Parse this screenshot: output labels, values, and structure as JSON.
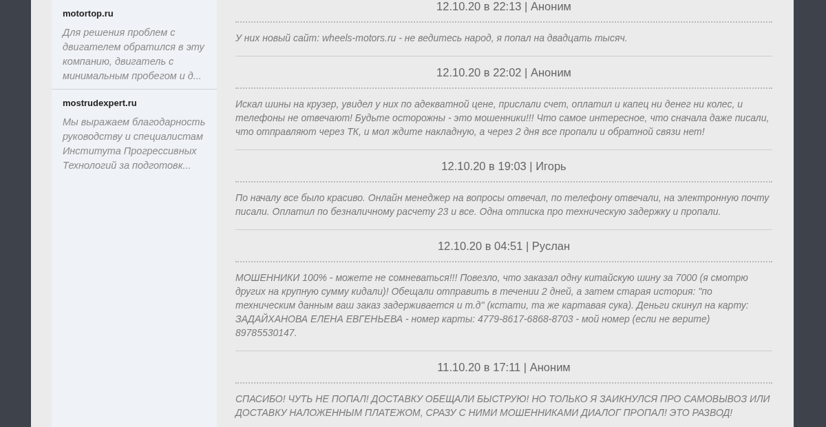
{
  "sidebar": {
    "items": [
      {
        "site": "motortop.ru",
        "excerpt": "Для решения проблем с двигателем обратился в эту компанию, двигатель с минимальным пробегом и д..."
      },
      {
        "site": "mostrudexpert.ru",
        "excerpt": "Мы выражаем благодарность руководству и специалистам Института Прогрессивных Технологий за подготовк..."
      }
    ]
  },
  "reviews": [
    {
      "header": "12.10.20 в 22:13 | Аноним",
      "text": "У них новый сайт: wheels-motors.ru - не ведитесь народ, я попал на двадцать тысяч."
    },
    {
      "header": "12.10.20 в 22:02 | Аноним",
      "text": "Искал шины на крузер, увидел у них по адекватной цене, прислали счет, оплатил и капец ни денег ни колес, и телефоны не отвечают! Будьте осторожны - это мошенники!!! Что самое интересное, что сначала даже писали, что отправляют через ТК, и мол ждите накладную, а через 2 дня все пропали и обратной связи нет!"
    },
    {
      "header": "12.10.20 в 19:03 | Игорь",
      "text": "По началу все было красиво. Онлайн менеджер на вопросы отвечал, по телефону отвечали, на электронную почту писали. Оплатил по безналичному расчету 23 и все. Одна отписка про техническую задержку и пропали."
    },
    {
      "header": "12.10.20 в 04:51 | Руслан",
      "text": "МОШЕННИКИ 100% - можете не сомневаться!!! Повезло, что заказал одну китайскую шину за 7000 (я смотрю других на крупную сумму кидали)! Обещали отправить в течении 2 дней, а затем старая история: \"по техническим данным ваш заказ задерживается и т.д\" (кстати, та же картавая сука). Деньги скинул на карту: ЗАДАЙХАНОВА ЕЛЕНА ЕВГЕНЬЕВА - номер карты: 4779-8617-6868-8703 - мой номер (если не верите) 89785530147."
    },
    {
      "header": "11.10.20 в 17:11 | Аноним",
      "text": "СПАСИБО! ЧУТЬ НЕ ПОПАЛ! ДОСТАВКУ ОБЕЩАЛИ БЫСТРУЮ! НО ТОЛЬКО Я ЗАИКНУЛСЯ ПРО САМОВЫВОЗ ИЛИ ДОСТАВКУ НАЛОЖЕННЫМ ПЛАТЕЖОМ, СРАЗУ С НИМИ МОШЕННИКАМИ ДИАЛОГ ПРОПАЛ! ЭТО РАЗВОД!"
    }
  ]
}
